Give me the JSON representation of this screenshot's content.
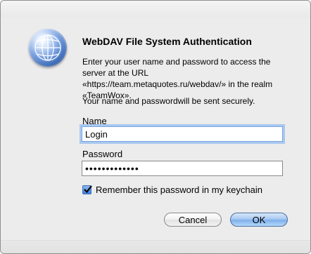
{
  "dialog": {
    "title": "WebDAV File System Authentication",
    "message": "Enter your user name and password to access the server at the URL «https://team.metaquotes.ru/webdav/» in the realm «TeamWox».",
    "secure_note": "Your name and passwordwill be sent securely.",
    "name_label": "Name",
    "name_value": "Login",
    "password_label": "Password",
    "password_value": "•••••••••••••",
    "remember_label": "Remember this password in my keychain",
    "remember_checked": true,
    "cancel_label": "Cancel",
    "ok_label": "OK",
    "icon": "network-globe-icon"
  }
}
